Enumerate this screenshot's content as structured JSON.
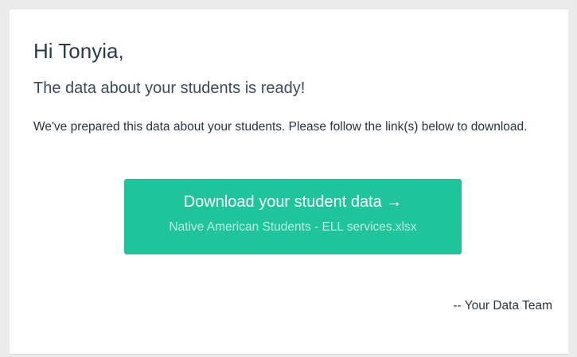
{
  "email": {
    "greeting": "Hi Tonyia,",
    "headline": "The data about your students is ready!",
    "body": "We've prepared this data about your students. Please follow the link(s) below to download.",
    "download_button": {
      "label": "Download your student data →",
      "filename": "Native American Students - ELL services.xlsx"
    },
    "signoff": "-- Your Data Team"
  },
  "colors": {
    "page_background": "#ebebeb",
    "card_background": "#ffffff",
    "button_background": "#1fc49c",
    "button_subtext": "#b8efdf",
    "text_dark": "#2a3440"
  }
}
